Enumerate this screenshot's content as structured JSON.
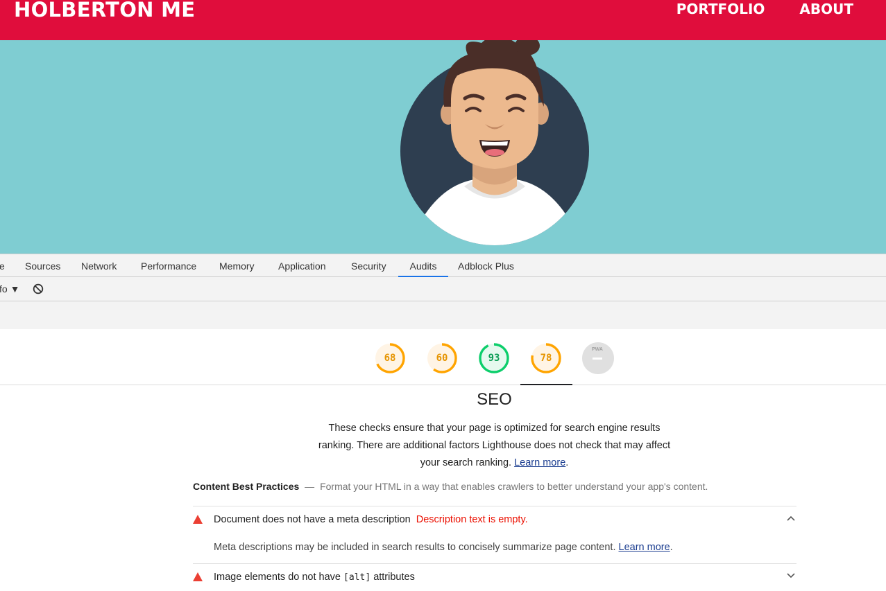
{
  "site": {
    "logo": "HOLBERTON ME",
    "nav": [
      "PORTFOLIO",
      "ABOUT"
    ],
    "header_color": "#e00d3c",
    "hero_color": "#7fcdd2"
  },
  "devtools": {
    "tabs": [
      {
        "label": "e",
        "active": false
      },
      {
        "label": "Sources",
        "active": false
      },
      {
        "label": "Network",
        "active": false
      },
      {
        "label": "Performance",
        "active": false
      },
      {
        "label": "Memory",
        "active": false
      },
      {
        "label": "Application",
        "active": false
      },
      {
        "label": "Security",
        "active": false
      },
      {
        "label": "Audits",
        "active": true
      },
      {
        "label": "Adblock Plus",
        "active": false
      }
    ],
    "toolbar": {
      "level_label": "fo ▼",
      "clear_icon": "no-entry-icon"
    }
  },
  "lighthouse": {
    "scores": [
      {
        "value": "68",
        "fraction": 0.68,
        "color": "#ffa400"
      },
      {
        "value": "60",
        "fraction": 0.6,
        "color": "#ffa400"
      },
      {
        "value": "93",
        "fraction": 0.93,
        "color": "#0cce6b"
      },
      {
        "value": "78",
        "fraction": 0.78,
        "color": "#ffa400",
        "selected": true
      }
    ],
    "pwa": {
      "label": "PWA"
    },
    "section": {
      "title": "SEO",
      "description": "These checks ensure that your page is optimized for search engine results ranking. There are additional factors Lighthouse does not check that may affect your search ranking.",
      "learn_more": "Learn more"
    },
    "group": {
      "title": "Content Best Practices",
      "separator": "—",
      "description": "Format your HTML in a way that enables crawlers to better understand your app's content."
    },
    "audits": [
      {
        "title": "Document does not have a meta description",
        "error": "Description text is empty.",
        "body": "Meta descriptions may be included in search results to concisely summarize page content.",
        "learn_more": "Learn more",
        "expanded": true
      },
      {
        "title_prefix": "Image elements do not have",
        "title_code": "[alt]",
        "title_suffix": "attributes",
        "expanded": false
      }
    ]
  }
}
